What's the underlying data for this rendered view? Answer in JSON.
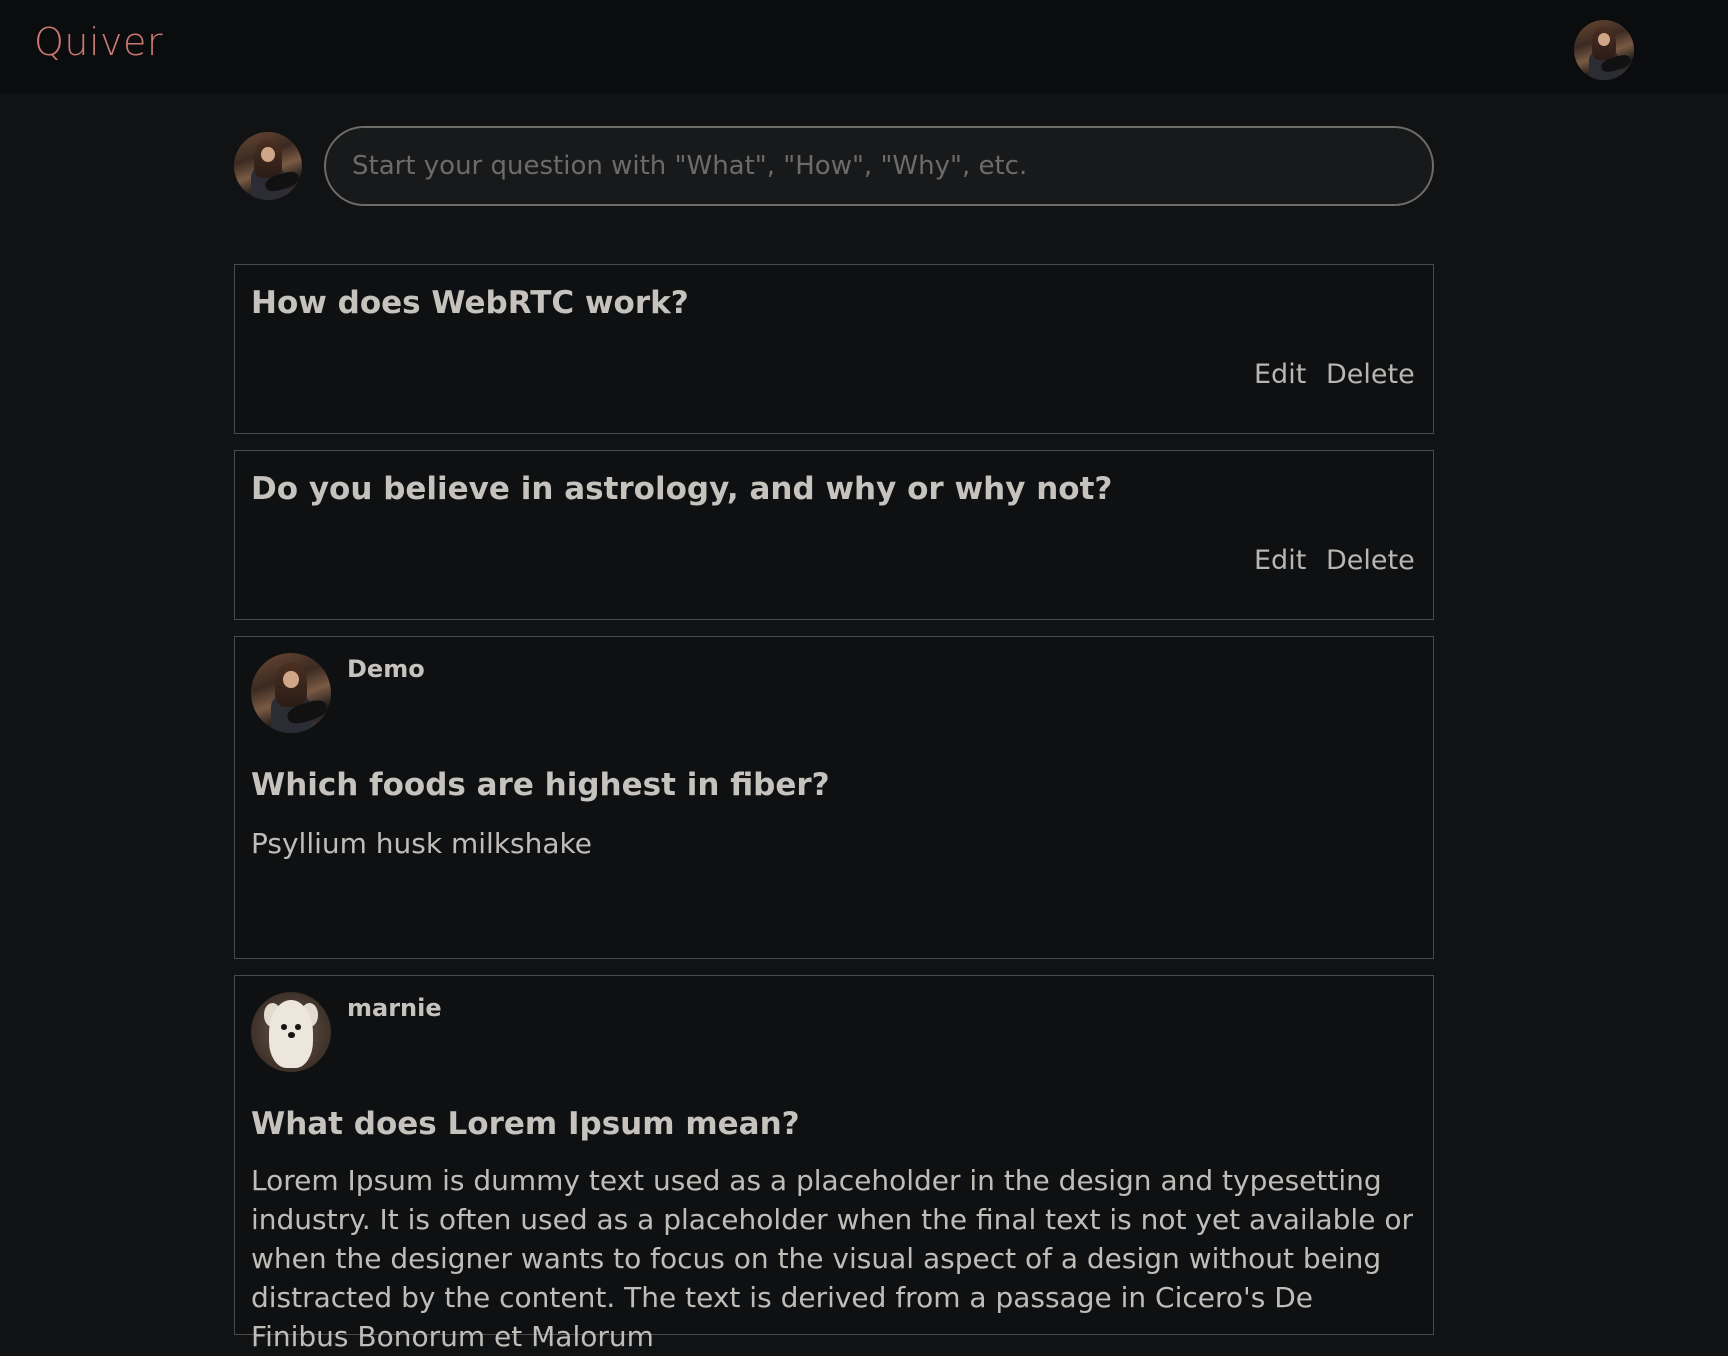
{
  "navbar": {
    "brand": "Quiver",
    "profile_avatar": "user-avatar-guitar"
  },
  "ask": {
    "placeholder": "Start your question with \"What\", \"How\", \"Why\", etc."
  },
  "questions": [
    {
      "title": "How does WebRTC work?",
      "edit_label": "Edit",
      "delete_label": "Delete"
    },
    {
      "title": "Do you believe in astrology, and why or why not?",
      "edit_label": "Edit",
      "delete_label": "Delete"
    }
  ],
  "answers": [
    {
      "author": "Demo",
      "avatar": "user-avatar-guitar",
      "question": "Which foods are highest in fiber?",
      "body": "Psyllium husk milkshake"
    },
    {
      "author": "marnie",
      "avatar": "user-avatar-dog",
      "question": "What does Lorem Ipsum mean?",
      "body": "Lorem Ipsum is dummy text used as a placeholder in the design and typesetting industry. It is often used as a placeholder when the final text is not yet available or when the designer wants to focus on the visual aspect of a design without being distracted by the content. The text is derived from a passage in Cicero's De Finibus Bonorum et Malorum"
    }
  ]
}
